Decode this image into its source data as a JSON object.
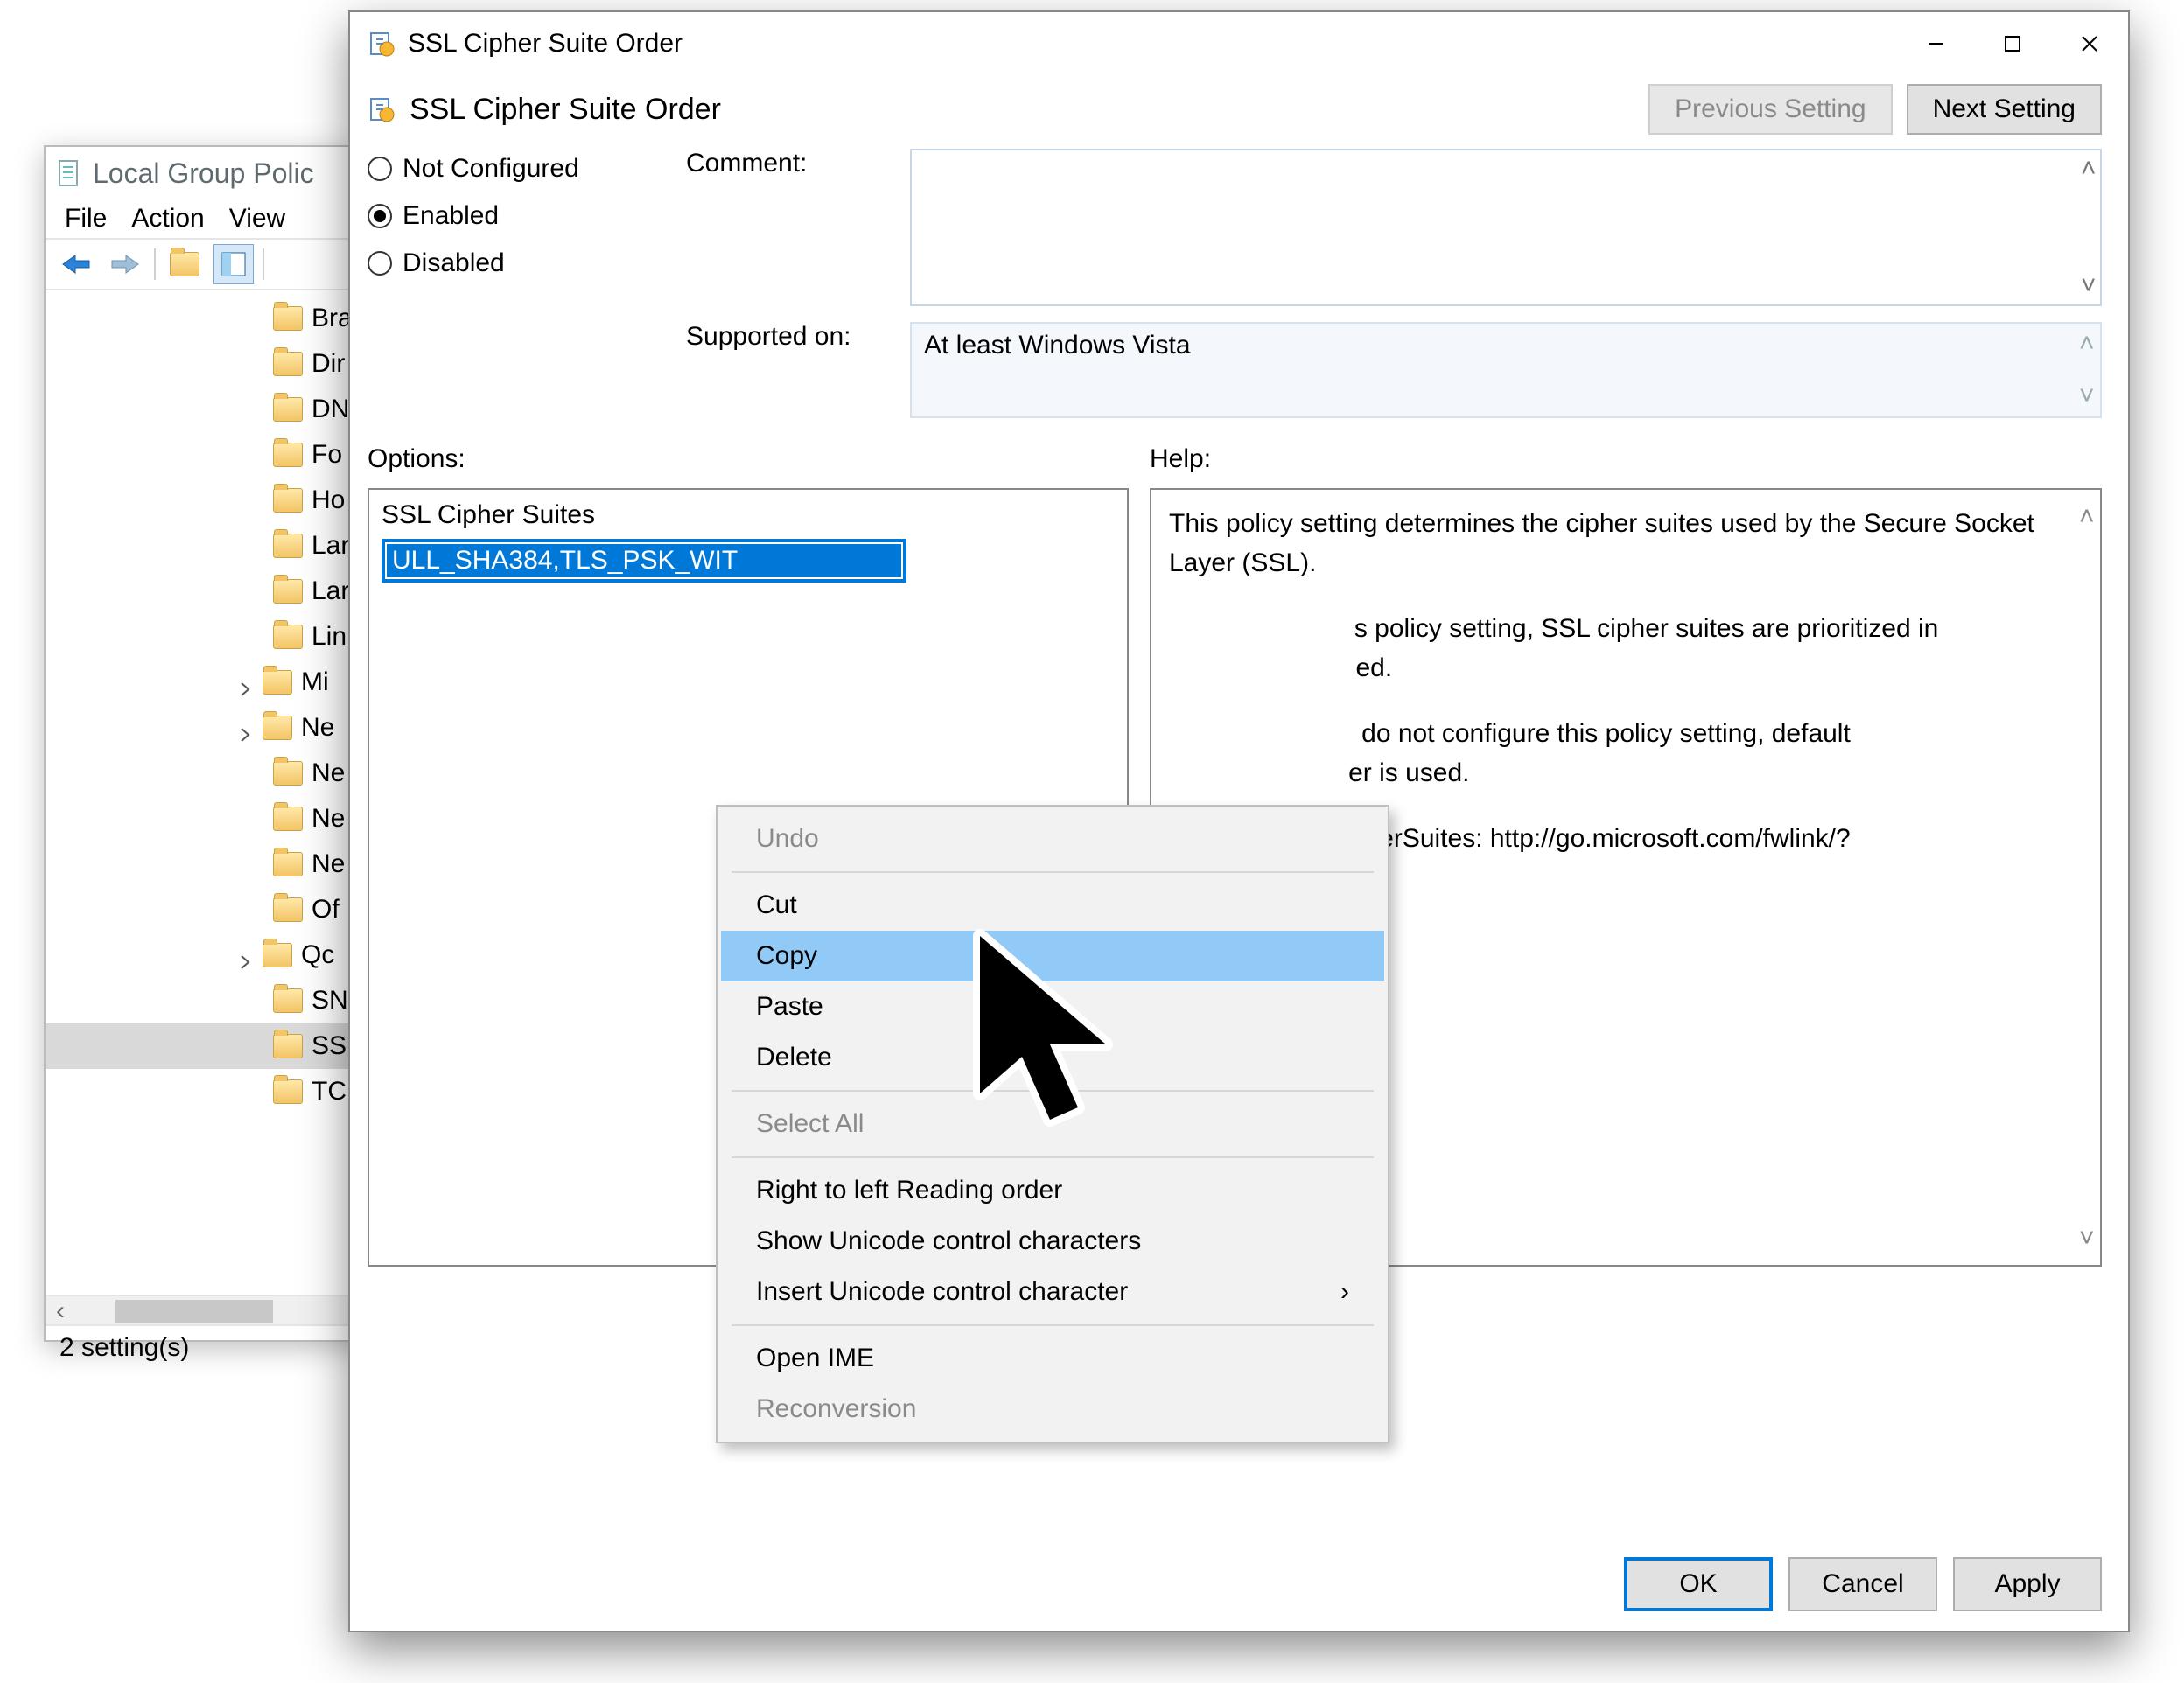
{
  "gpedit": {
    "title": "Local Group Polic",
    "menu": {
      "file": "File",
      "action": "Action",
      "view": "View"
    },
    "tree": [
      {
        "label": "Bra",
        "sel": false,
        "exp": false
      },
      {
        "label": "Dir",
        "sel": false,
        "exp": false
      },
      {
        "label": "DN",
        "sel": false,
        "exp": false
      },
      {
        "label": "Fo",
        "sel": false,
        "exp": false
      },
      {
        "label": "Ho",
        "sel": false,
        "exp": false
      },
      {
        "label": "Lar",
        "sel": false,
        "exp": false
      },
      {
        "label": "Lar",
        "sel": false,
        "exp": false
      },
      {
        "label": "Lin",
        "sel": false,
        "exp": false
      },
      {
        "label": "Mi",
        "sel": false,
        "exp": true
      },
      {
        "label": "Ne",
        "sel": false,
        "exp": true
      },
      {
        "label": "Ne",
        "sel": false,
        "exp": false
      },
      {
        "label": "Ne",
        "sel": false,
        "exp": false
      },
      {
        "label": "Ne",
        "sel": false,
        "exp": false
      },
      {
        "label": "Of",
        "sel": false,
        "exp": false
      },
      {
        "label": "Qc",
        "sel": false,
        "exp": true
      },
      {
        "label": "SN",
        "sel": false,
        "exp": false
      },
      {
        "label": "SS",
        "sel": true,
        "exp": false
      },
      {
        "label": "TC",
        "sel": false,
        "exp": false
      }
    ],
    "status": "2 setting(s)"
  },
  "dialog": {
    "title": "SSL Cipher Suite Order",
    "subtitle": "SSL Cipher Suite Order",
    "prev": "Previous Setting",
    "next": "Next Setting",
    "radios": {
      "not_configured": "Not Configured",
      "enabled": "Enabled",
      "disabled": "Disabled"
    },
    "comment_label": "Comment:",
    "supported_label": "Supported on:",
    "supported_value": "At least Windows Vista",
    "options_label": "Options:",
    "help_label": "Help:",
    "cipher_label": "SSL Cipher Suites",
    "cipher_value": "ULL_SHA384,TLS_PSK_WIT",
    "help_text": {
      "p1": "This policy setting determines the cipher suites used by the Secure Socket Layer (SSL).",
      "p2a": "s policy setting, SSL cipher suites are prioritized in",
      "p2b": "ed.",
      "p3a": " do not configure this policy setting, default",
      "p3b": "er is used.",
      "p4": "pherSuites: http://go.microsoft.com/fwlink/?"
    },
    "buttons": {
      "ok": "OK",
      "cancel": "Cancel",
      "apply": "Apply"
    }
  },
  "ctx": {
    "undo": "Undo",
    "cut": "Cut",
    "copy": "Copy",
    "paste": "Paste",
    "delete": "Delete",
    "select_all": "Select All",
    "rtl": "Right to left Reading order",
    "show_uni": "Show Unicode control characters",
    "insert_uni": "Insert Unicode control character",
    "ime": "Open IME",
    "reconv": "Reconversion"
  }
}
